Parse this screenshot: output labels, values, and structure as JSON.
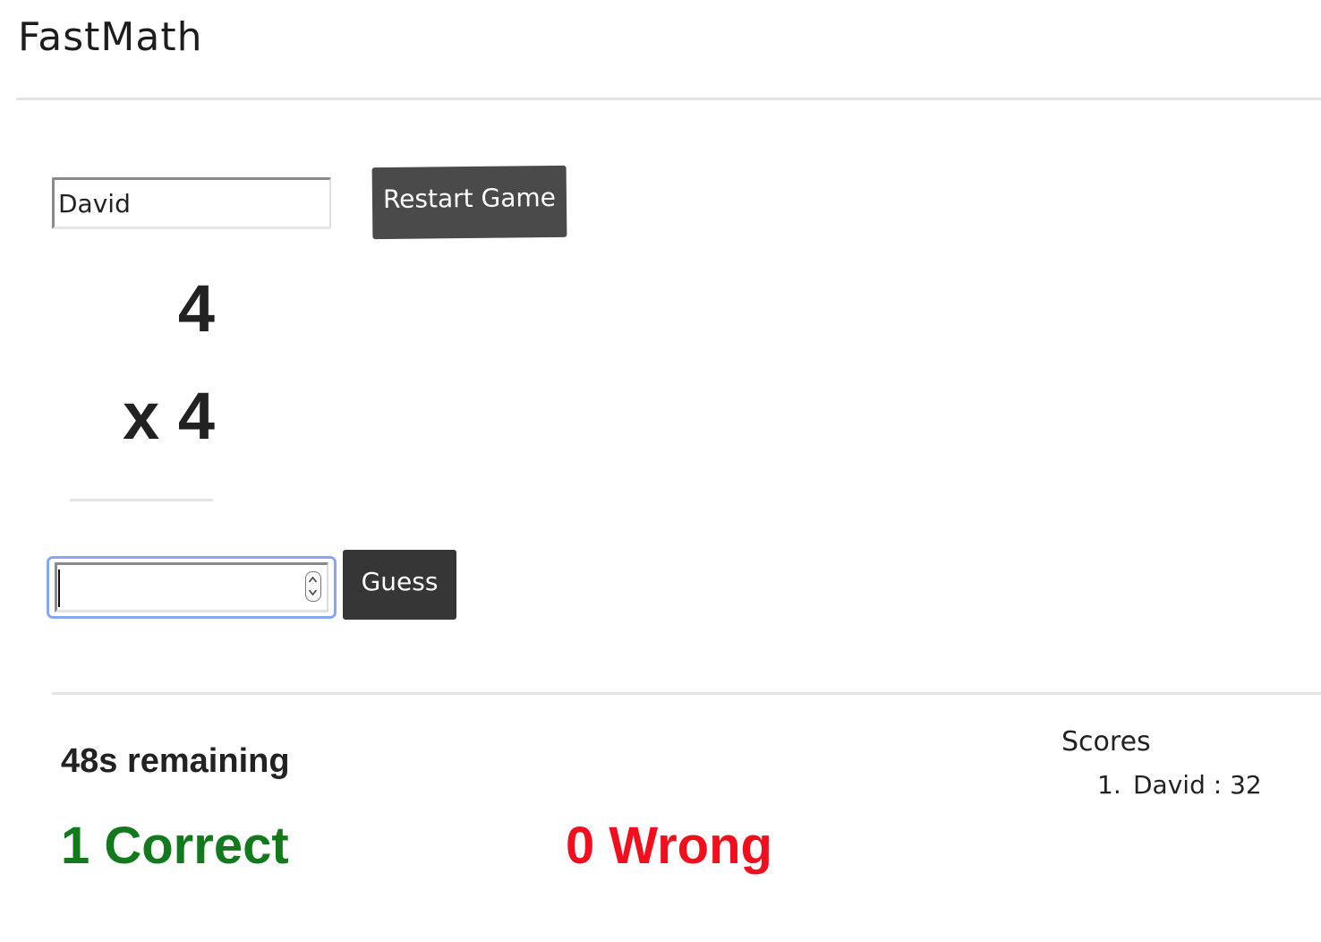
{
  "app": {
    "title": "FastMath"
  },
  "controls": {
    "name_value": "David",
    "restart_label": "Restart Game"
  },
  "problem": {
    "operand_top": "4",
    "operand_bottom": "x 4"
  },
  "answer": {
    "value": "",
    "guess_label": "Guess"
  },
  "status": {
    "time_remaining": "48s remaining",
    "correct": "1 Correct",
    "wrong": "0 Wrong"
  },
  "scores": {
    "heading": "Scores",
    "entries": [
      {
        "rank": "1.",
        "text": "David : 32"
      }
    ]
  },
  "colors": {
    "correct": "#127a1c",
    "wrong": "#f10f1d",
    "button_bg": "#4a4a4a",
    "focus_ring": "#86a6f2"
  },
  "icons": {
    "spinner": "number-spinner-icon"
  }
}
